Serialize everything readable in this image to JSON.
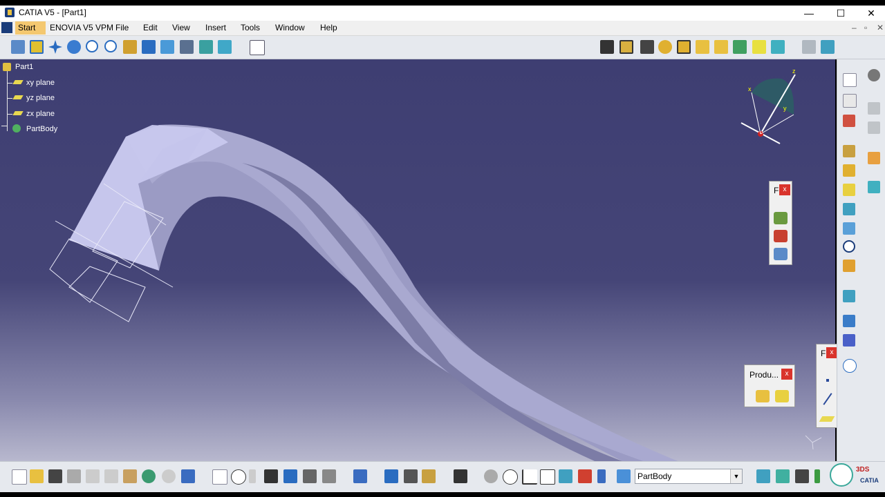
{
  "window": {
    "title": "CATIA V5 - [Part1]",
    "minimize_glyph": "—",
    "maximize_glyph": "☐",
    "close_glyph": "✕"
  },
  "menu": {
    "items": [
      "Start",
      "ENOVIA V5 VPM",
      "File",
      "Edit",
      "View",
      "Insert",
      "Tools",
      "Window",
      "Help"
    ],
    "doc_controls": [
      "–",
      "▫",
      "✕"
    ]
  },
  "tree": {
    "root": "Part1",
    "children": [
      "xy plane",
      "yz plane",
      "zx plane",
      "PartBody"
    ]
  },
  "compass_labels": {
    "x": "x",
    "y": "y",
    "z": "z"
  },
  "panels": {
    "f_panel_top": {
      "title": "F",
      "close": "x"
    },
    "product_panel": {
      "title": "Produ...",
      "close": "x"
    },
    "f_panel_right": {
      "title": "F",
      "close": "x"
    }
  },
  "bottom": {
    "combo_value": "PartBody",
    "brand": "CATIA",
    "brand_mark": "3DS"
  },
  "icons": {
    "top_toolbar": [
      "fly-mode-icon",
      "fit-all-in-icon",
      "pan-icon",
      "rotate-icon",
      "zoom-in-icon",
      "zoom-out-icon",
      "normal-view-icon",
      "multi-view-icon",
      "iso-view-icon",
      "view-mode-icon",
      "hide-show-icon",
      "swap-space-icon",
      "sketcher-icon"
    ],
    "top_right_toolbar": [
      "pad-icon",
      "pocket-icon",
      "shaft-icon",
      "groove-icon",
      "hole-icon",
      "rib-icon",
      "slot-icon",
      "stiffener-icon",
      "multi-section-icon",
      "removed-multi-section-icon",
      "constraints-icon",
      "update-icon"
    ],
    "bottom_toolbar": [
      "new-icon",
      "open-icon",
      "save-icon",
      "print-icon",
      "cut-icon",
      "copy-icon",
      "paste-icon",
      "undo-icon",
      "redo-icon",
      "whats-this-icon",
      "formula-icon",
      "comment-icon",
      "measure-icon",
      "table-icon",
      "catalog-icon",
      "analysis-icon",
      "knowledge-icon",
      "snapshot-icon",
      "measure-between-icon",
      "measure-item-icon",
      "mass-icon",
      "capture-icon",
      "threaded-icon",
      "sweep-icon",
      "axis-system-icon",
      "10-10-icon",
      "grid-icon",
      "check-icon",
      "set-icon",
      "working-support-icon"
    ]
  },
  "colors": {
    "viewport_top": "#3e3e72",
    "viewport_bottom": "#b8b8ce",
    "part_face": "#c8c8ee",
    "part_side": "#9090b8",
    "start_highlight": "#f4c870"
  }
}
